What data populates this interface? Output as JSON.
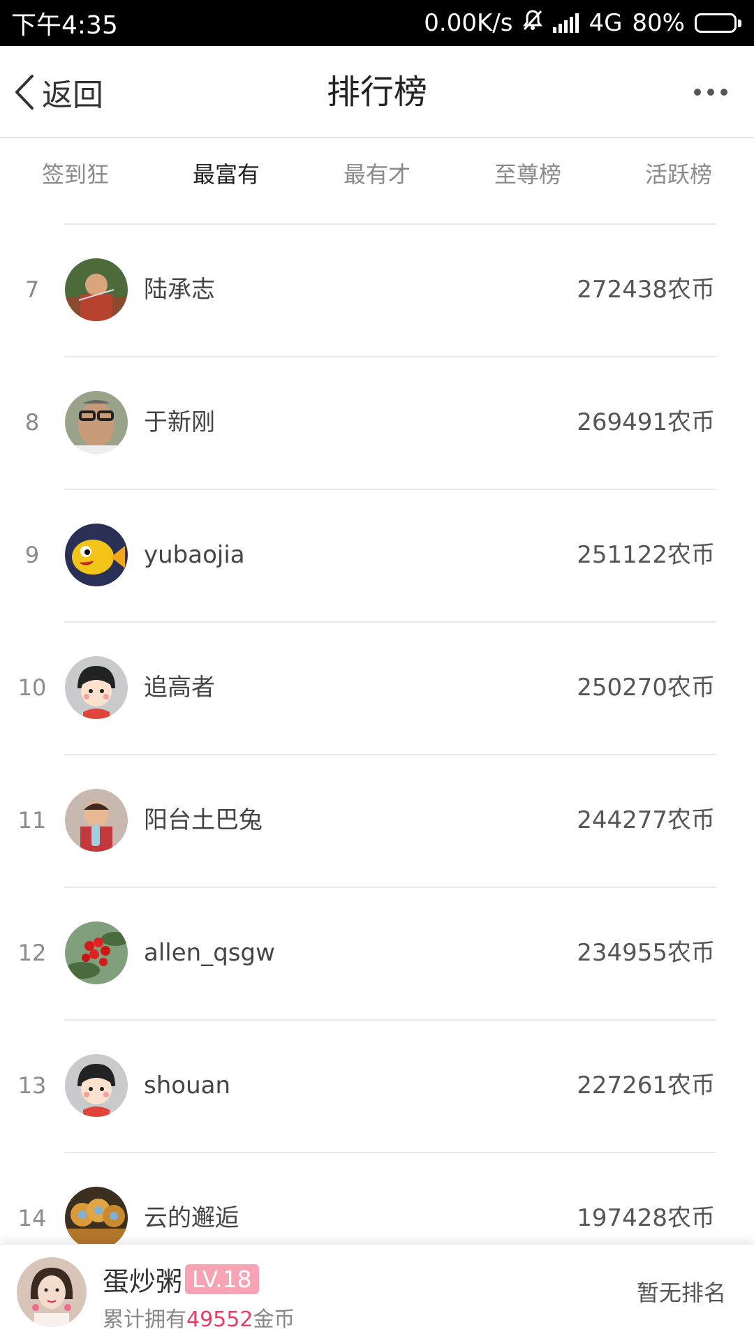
{
  "status_bar": {
    "time": "下午4:35",
    "speed": "0.00K/s",
    "network": "4G",
    "battery": "80%",
    "battery_level": 0.8
  },
  "nav": {
    "back_label": "返回",
    "title": "排行榜"
  },
  "tabs": [
    {
      "label": "签到狂",
      "active": false
    },
    {
      "label": "最富有",
      "active": true
    },
    {
      "label": "最有才",
      "active": false
    },
    {
      "label": "至尊榜",
      "active": false
    },
    {
      "label": "活跃榜",
      "active": false
    }
  ],
  "ranking": [
    {
      "rank": "7",
      "name": "陆承志",
      "score": "272438农币",
      "avatar": "photo-man-outdoors"
    },
    {
      "rank": "8",
      "name": "于新刚",
      "score": "269491农币",
      "avatar": "photo-man-glasses"
    },
    {
      "rank": "9",
      "name": "yubaojia",
      "score": "251122农币",
      "avatar": "cartoon-fish"
    },
    {
      "rank": "10",
      "name": "追高者",
      "score": "250270农币",
      "avatar": "default-cartoon-girl"
    },
    {
      "rank": "11",
      "name": "阳台土巴兔",
      "score": "244277农币",
      "avatar": "photo-child"
    },
    {
      "rank": "12",
      "name": "allen_qsgw",
      "score": "234955农币",
      "avatar": "photo-red-berries"
    },
    {
      "rank": "13",
      "name": "shouan",
      "score": "227261农币",
      "avatar": "default-cartoon-girl"
    },
    {
      "rank": "14",
      "name": "云的邂逅",
      "score": "197428农币",
      "avatar": "photo-monkeys"
    }
  ],
  "me": {
    "name": "蛋炒粥",
    "level": "LV.18",
    "coins_prefix": "累计拥有",
    "coins": "49552",
    "coins_suffix": "金币",
    "rank_status": "暂无排名",
    "avatar": "photo-woman"
  }
}
